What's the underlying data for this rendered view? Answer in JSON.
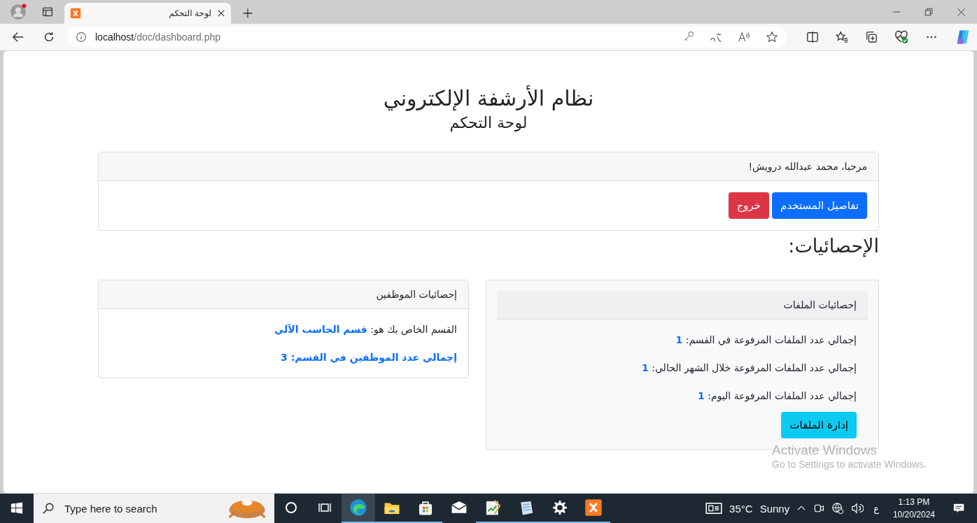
{
  "browser": {
    "tab": {
      "title": "لوحة التحكم",
      "selected": true
    },
    "url": {
      "host": "localhost",
      "path": "/doc/dashboard.php"
    }
  },
  "page": {
    "title": "نظام الأرشفة الإلكتروني",
    "subtitle": "لوحة التحكم",
    "welcome": {
      "greeting": "مرحبا، محمد عبدالله درويش!",
      "buttons": [
        {
          "label": "تفاصيل المستخدم",
          "kind": "primary"
        },
        {
          "label": "خروج",
          "kind": "danger"
        }
      ]
    },
    "stats_heading": "الإحصائيات:",
    "files_card": {
      "title": "إحصائيات الملفات",
      "items": [
        {
          "label": "إجمالي عدد الملفات المرفوعة في القسم:",
          "value": "1"
        },
        {
          "label": "إجمالي عدد الملفات المرفوعة خلال الشهر الحالي:",
          "value": "1"
        },
        {
          "label": "إجمالي عدد الملفات المرفوعة اليوم:",
          "value": "1"
        }
      ],
      "button": "إدارة الملفات"
    },
    "employees_card": {
      "title": "إحصائيات الموظفين",
      "items": [
        {
          "kind": "plain",
          "label": "القسم الخاص بك هو:",
          "value": "قسم الحاسب الآلي"
        },
        {
          "kind": "highlight",
          "label": "إجمالي عدد الموظفين في القسم:",
          "value": "3"
        }
      ]
    }
  },
  "activation": {
    "title": "Activate Windows",
    "hint": "Go to Settings to activate Windows."
  },
  "taskbar": {
    "search_placeholder": "Type here to search",
    "apps": [
      {
        "kind": "cortana",
        "running": false,
        "selected": false
      },
      {
        "kind": "taskview",
        "running": false,
        "selected": false
      },
      {
        "kind": "edge",
        "running": true,
        "selected": true
      },
      {
        "kind": "explorer",
        "running": true,
        "selected": false
      },
      {
        "kind": "store",
        "running": true,
        "selected": false
      },
      {
        "kind": "mail",
        "running": false,
        "selected": false
      },
      {
        "kind": "notepad",
        "running": true,
        "selected": false
      },
      {
        "kind": "notes",
        "running": true,
        "selected": false
      },
      {
        "kind": "settings",
        "running": true,
        "selected": false
      },
      {
        "kind": "xampp",
        "running": true,
        "selected": false
      }
    ],
    "temperature": "35°C",
    "condition": "Sunny",
    "input_language": "ع",
    "time": "1:13 PM",
    "date": "10/20/2024"
  }
}
